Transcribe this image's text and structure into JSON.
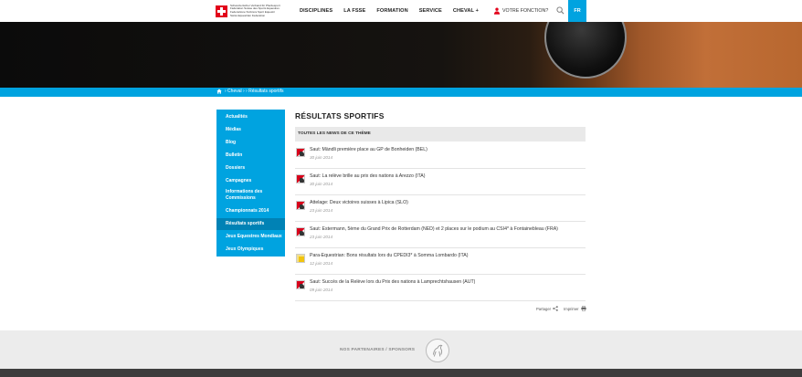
{
  "header": {
    "logo_lines": [
      "Schweizerischer Verband für Pferdesport",
      "Fédération Suisse des Sports Equestres",
      "Federazione Svizzera Sport Equestri",
      "Swiss Equestrian Federation"
    ],
    "nav": [
      "DISCIPLINES",
      "LA FSSE",
      "FORMATION",
      "SERVICE",
      "CHEVAL +"
    ],
    "fonction_label": "VOTRE FONCTION?",
    "lang": "FR"
  },
  "breadcrumb": "› Cheval › › Résultats sportifs",
  "sidebar": {
    "items": [
      "Actualités",
      "Médias",
      "Blog",
      "Bulletin",
      "Dossiers",
      "Campagnes",
      "Informations des",
      "Commissions",
      "Championnats 2014",
      "Résultats sportifs",
      "Jeux Equestres Mondiaux",
      "Jeux Olympiques"
    ]
  },
  "main": {
    "title": "RÉSULTATS SPORTIFS",
    "section": "TOUTES LES NEWS DE CE THÈME",
    "news": [
      {
        "title": "Saut: Mändli première place au GP de Bonheiden (BEL)",
        "date": "30 juin 2014"
      },
      {
        "title": "Saut: La relève brille au prix des nations à Arezzo (ITA)",
        "date": "30 juin 2014"
      },
      {
        "title": "Attelage: Deux victoires suisses à Lipica (SLO)",
        "date": "23 juin 2014"
      },
      {
        "title": "Saut: Estermann, 5ème du Grand Prix de Rotterdam (NED) et 2 places sur le podium au CSI4* à Fontainebleau (FRA)",
        "date": "23 juin 2014"
      },
      {
        "title": "Para-Equestrian: Bons résultats lors du CPEDI3* à Somma Lombardo (ITA)",
        "date": "12 juin 2014"
      },
      {
        "title": "Saut: Succès de la Relève lors du Prix des nations à Lamprechtshausen (AUT)",
        "date": "09 juin 2014"
      }
    ],
    "share_label": "Partager",
    "print_label": "Imprimer"
  },
  "footer": {
    "partners_label": "NOS PARTENAIRES / SPONSORS"
  }
}
